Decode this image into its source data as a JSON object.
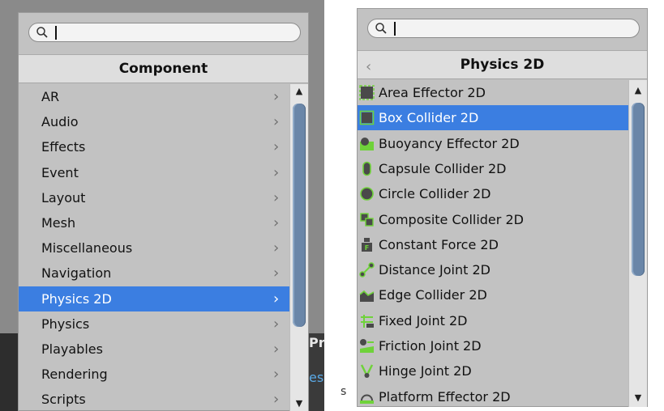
{
  "left_panel": {
    "header": "Component",
    "items": [
      {
        "label": "AR"
      },
      {
        "label": "Audio"
      },
      {
        "label": "Effects"
      },
      {
        "label": "Event"
      },
      {
        "label": "Layout"
      },
      {
        "label": "Mesh"
      },
      {
        "label": "Miscellaneous"
      },
      {
        "label": "Navigation"
      },
      {
        "label": "Physics 2D",
        "selected": true
      },
      {
        "label": "Physics"
      },
      {
        "label": "Playables"
      },
      {
        "label": "Rendering"
      },
      {
        "label": "Scripts"
      }
    ]
  },
  "right_panel": {
    "header": "Physics 2D",
    "items": [
      {
        "label": "Area Effector 2D",
        "icon": "area-effector-icon"
      },
      {
        "label": "Box Collider 2D",
        "icon": "box-collider-icon",
        "selected": true
      },
      {
        "label": "Buoyancy Effector 2D",
        "icon": "buoyancy-effector-icon"
      },
      {
        "label": "Capsule Collider 2D",
        "icon": "capsule-collider-icon"
      },
      {
        "label": "Circle Collider 2D",
        "icon": "circle-collider-icon"
      },
      {
        "label": "Composite Collider 2D",
        "icon": "composite-collider-icon"
      },
      {
        "label": "Constant Force 2D",
        "icon": "constant-force-icon"
      },
      {
        "label": "Distance Joint 2D",
        "icon": "distance-joint-icon"
      },
      {
        "label": "Edge Collider 2D",
        "icon": "edge-collider-icon"
      },
      {
        "label": "Fixed Joint 2D",
        "icon": "fixed-joint-icon"
      },
      {
        "label": "Friction Joint 2D",
        "icon": "friction-joint-icon"
      },
      {
        "label": "Hinge Joint 2D",
        "icon": "hinge-joint-icon"
      },
      {
        "label": "Platform Effector 2D",
        "icon": "platform-effector-icon"
      }
    ]
  },
  "background": {
    "left_fragment_1": "Pr",
    "left_fragment_2": "es",
    "right_fragment": "s"
  },
  "colors": {
    "selection": "#3b7ee1",
    "icon_green": "#6fd23a",
    "icon_dark": "#4a4a4a"
  }
}
